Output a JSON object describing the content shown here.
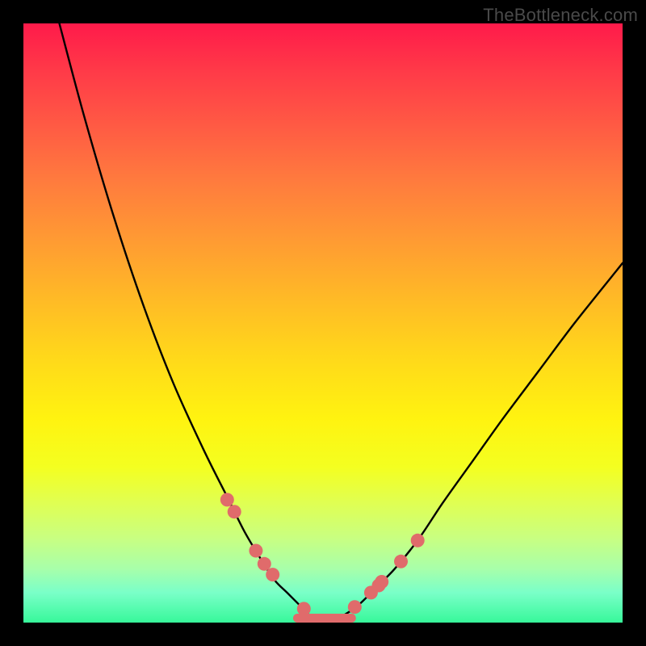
{
  "watermark": "TheBottleneck.com",
  "chart_data": {
    "type": "line",
    "title": "",
    "xlabel": "",
    "ylabel": "",
    "xlim": [
      0,
      100
    ],
    "ylim": [
      0,
      100
    ],
    "curve_left": {
      "name": "left-branch",
      "x": [
        6,
        10,
        15,
        20,
        25,
        30,
        34,
        37,
        40,
        42,
        44,
        46,
        48,
        50
      ],
      "y": [
        100,
        85,
        68,
        53,
        40,
        29,
        21,
        15,
        10,
        7,
        5,
        3,
        1,
        0
      ]
    },
    "curve_right": {
      "name": "right-branch",
      "x": [
        50,
        53,
        56,
        59,
        62,
        66,
        70,
        75,
        80,
        86,
        92,
        100
      ],
      "y": [
        0,
        1,
        3,
        6,
        9,
        14,
        20,
        27,
        34,
        42,
        50,
        60
      ]
    },
    "markers_left": {
      "name": "left-markers",
      "x": [
        34.0,
        35.2,
        38.8,
        40.2,
        41.6,
        46.8
      ],
      "y": [
        20.5,
        18.5,
        12.0,
        9.8,
        8.0,
        2.3
      ]
    },
    "markers_right": {
      "name": "right-markers",
      "x": [
        55.3,
        58.0,
        59.3,
        59.8,
        63.0,
        65.8
      ],
      "y": [
        2.6,
        5.0,
        6.2,
        6.8,
        10.2,
        13.7
      ]
    },
    "flat_band": {
      "name": "bottom-band",
      "x_start": 45.0,
      "x_end": 55.5,
      "y": 0
    },
    "gradient_stops": [
      {
        "pos": 0,
        "color": "#ff1a4a"
      },
      {
        "pos": 50,
        "color": "#ffe030"
      },
      {
        "pos": 100,
        "color": "#37f89a"
      }
    ],
    "curve_color": "#000000",
    "marker_color": "#e06b6b"
  }
}
